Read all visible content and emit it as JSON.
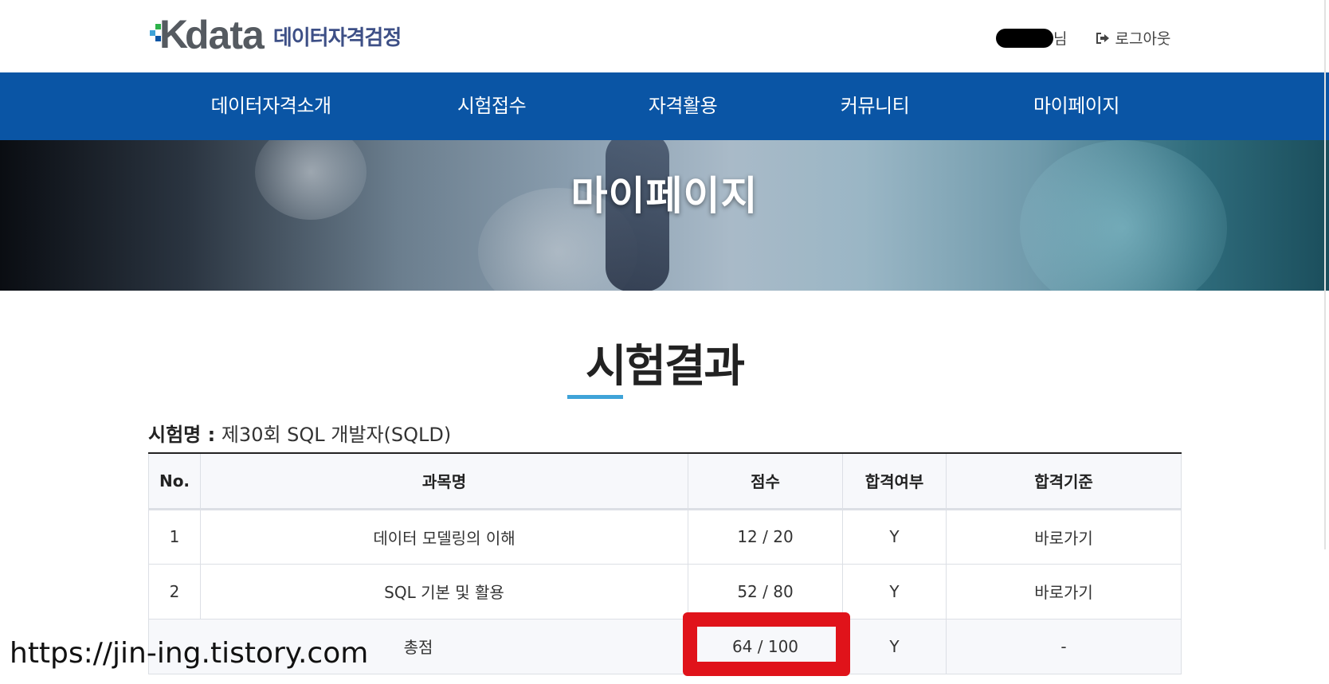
{
  "header": {
    "logo_word": "data",
    "logo_k": "K",
    "logo_sub": "데이터자격검정",
    "user_suffix": "님",
    "logout_label": "로그아웃"
  },
  "nav": {
    "items": [
      {
        "label": "데이터자격소개"
      },
      {
        "label": "시험접수"
      },
      {
        "label": "자격활용"
      },
      {
        "label": "커뮤니티"
      },
      {
        "label": "마이페이지"
      }
    ]
  },
  "banner": {
    "title": "마이페이지"
  },
  "section": {
    "title": "시험결과",
    "exam_label": "시험명 :",
    "exam_name": "제30회 SQL 개발자(SQLD)"
  },
  "table": {
    "headers": [
      "No.",
      "과목명",
      "점수",
      "합격여부",
      "합격기준"
    ],
    "rows": [
      {
        "no": "1",
        "subject": "데이터 모델링의 이해",
        "score": "12 / 20",
        "pass": "Y",
        "criteria": "바로가기"
      },
      {
        "no": "2",
        "subject": "SQL 기본 및 활용",
        "score": "52 / 80",
        "pass": "Y",
        "criteria": "바로가기"
      }
    ],
    "total": {
      "label": "총점",
      "score": "64 / 100",
      "pass": "Y",
      "criteria": "-"
    }
  },
  "watermark": "https://jin-ing.tistory.com",
  "colors": {
    "nav_bg": "#0a55a5",
    "accent_underline": "#3fa3d8",
    "highlight_box": "#e0131a",
    "logo_sub": "#3d4f86"
  }
}
